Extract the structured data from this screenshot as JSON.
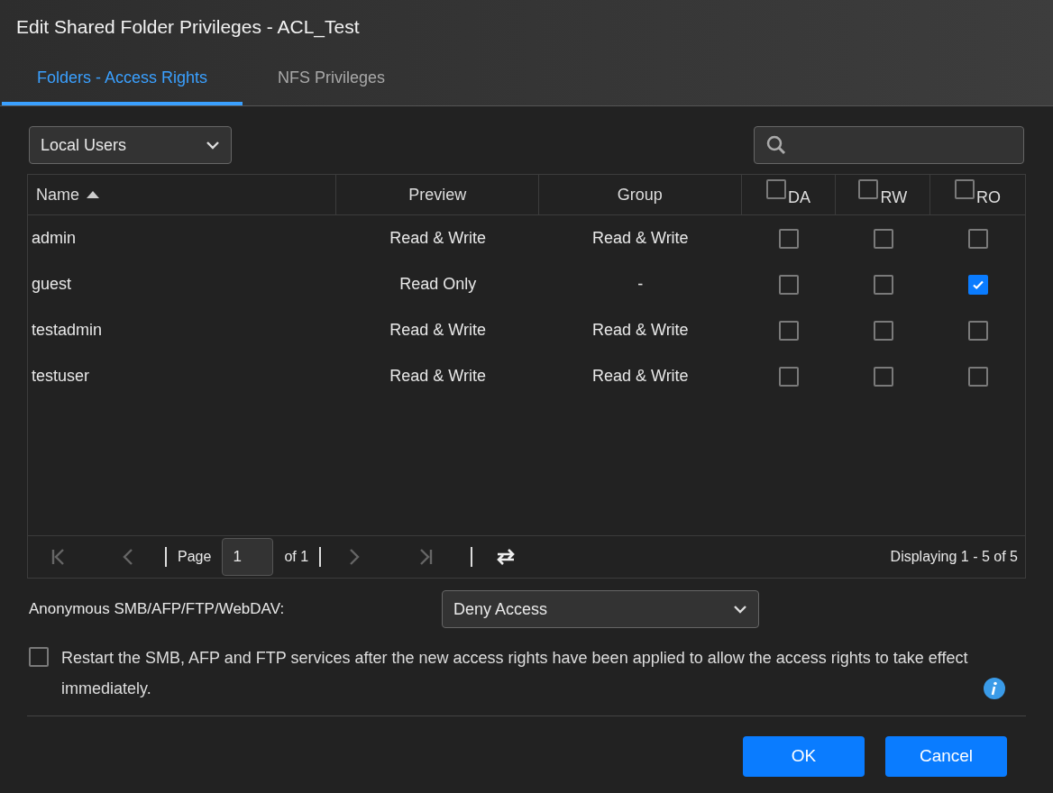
{
  "window": {
    "title": "Edit Shared Folder Privileges - ACL_Test"
  },
  "tabs": [
    {
      "label": "Folders - Access Rights",
      "selected": true
    },
    {
      "label": "NFS Privileges",
      "selected": false
    }
  ],
  "user_type_select": {
    "value": "Local Users"
  },
  "table": {
    "columns": [
      {
        "label": "Name",
        "sorted": true
      },
      {
        "label": "Preview"
      },
      {
        "label": "Group"
      }
    ],
    "permission_columns": [
      {
        "label": "DA",
        "checked": false
      },
      {
        "label": "RW",
        "checked": false
      },
      {
        "label": "RO",
        "checked": false
      }
    ],
    "rows": [
      {
        "name": "admin",
        "preview": "Read & Write",
        "group": "Read & Write",
        "permissions": [
          false,
          false,
          false
        ]
      },
      {
        "name": "guest",
        "preview": "Read Only",
        "group": "-",
        "permissions": [
          false,
          false,
          true
        ]
      },
      {
        "name": "testadmin",
        "preview": "Read & Write",
        "group": "Read & Write",
        "permissions": [
          false,
          false,
          false
        ]
      },
      {
        "name": "testuser",
        "preview": "Read & Write",
        "group": "Read & Write",
        "permissions": [
          false,
          false,
          false
        ]
      }
    ]
  },
  "pager": {
    "page_label": "Page",
    "page_value": "1",
    "of_label": "of 1",
    "display": "Displaying 1 - 5 of 5"
  },
  "anonymous": {
    "label": "Anonymous SMB/AFP/FTP/WebDAV:",
    "value": "Deny Access"
  },
  "restart": {
    "checked": false,
    "text": "Restart the SMB, AFP and FTP services after the new access rights have been applied to allow the access rights to take effect immediately."
  },
  "buttons": [
    {
      "label": "OK"
    },
    {
      "label": "Cancel"
    }
  ]
}
